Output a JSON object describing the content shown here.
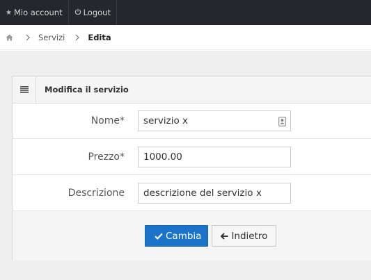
{
  "topbar": {
    "account_icon": "star-icon",
    "account_label": "Mio account",
    "logout_icon": "power-icon",
    "logout_label": "Logout"
  },
  "breadcrumb": {
    "home_icon": "home-icon",
    "items": [
      {
        "label": "Servizi"
      },
      {
        "label": "Edita"
      }
    ]
  },
  "panel": {
    "header_icon": "list-icon",
    "title": "Modifica il servizio"
  },
  "form": {
    "fields": [
      {
        "label": "Nome*",
        "value": "servizio x",
        "badge_icon": "contact-card-icon"
      },
      {
        "label": "Prezzo*",
        "value": "1000.00"
      },
      {
        "label": "Descrizione",
        "value": "descrizione del servizio x"
      }
    ],
    "submit_label": "Cambia",
    "submit_icon": "check-icon",
    "back_label": "Indietro",
    "back_icon": "arrow-left-icon"
  },
  "colors": {
    "topbar_bg": "#26272d",
    "primary": "#1a73c9",
    "content_bg": "#eeeeee"
  }
}
